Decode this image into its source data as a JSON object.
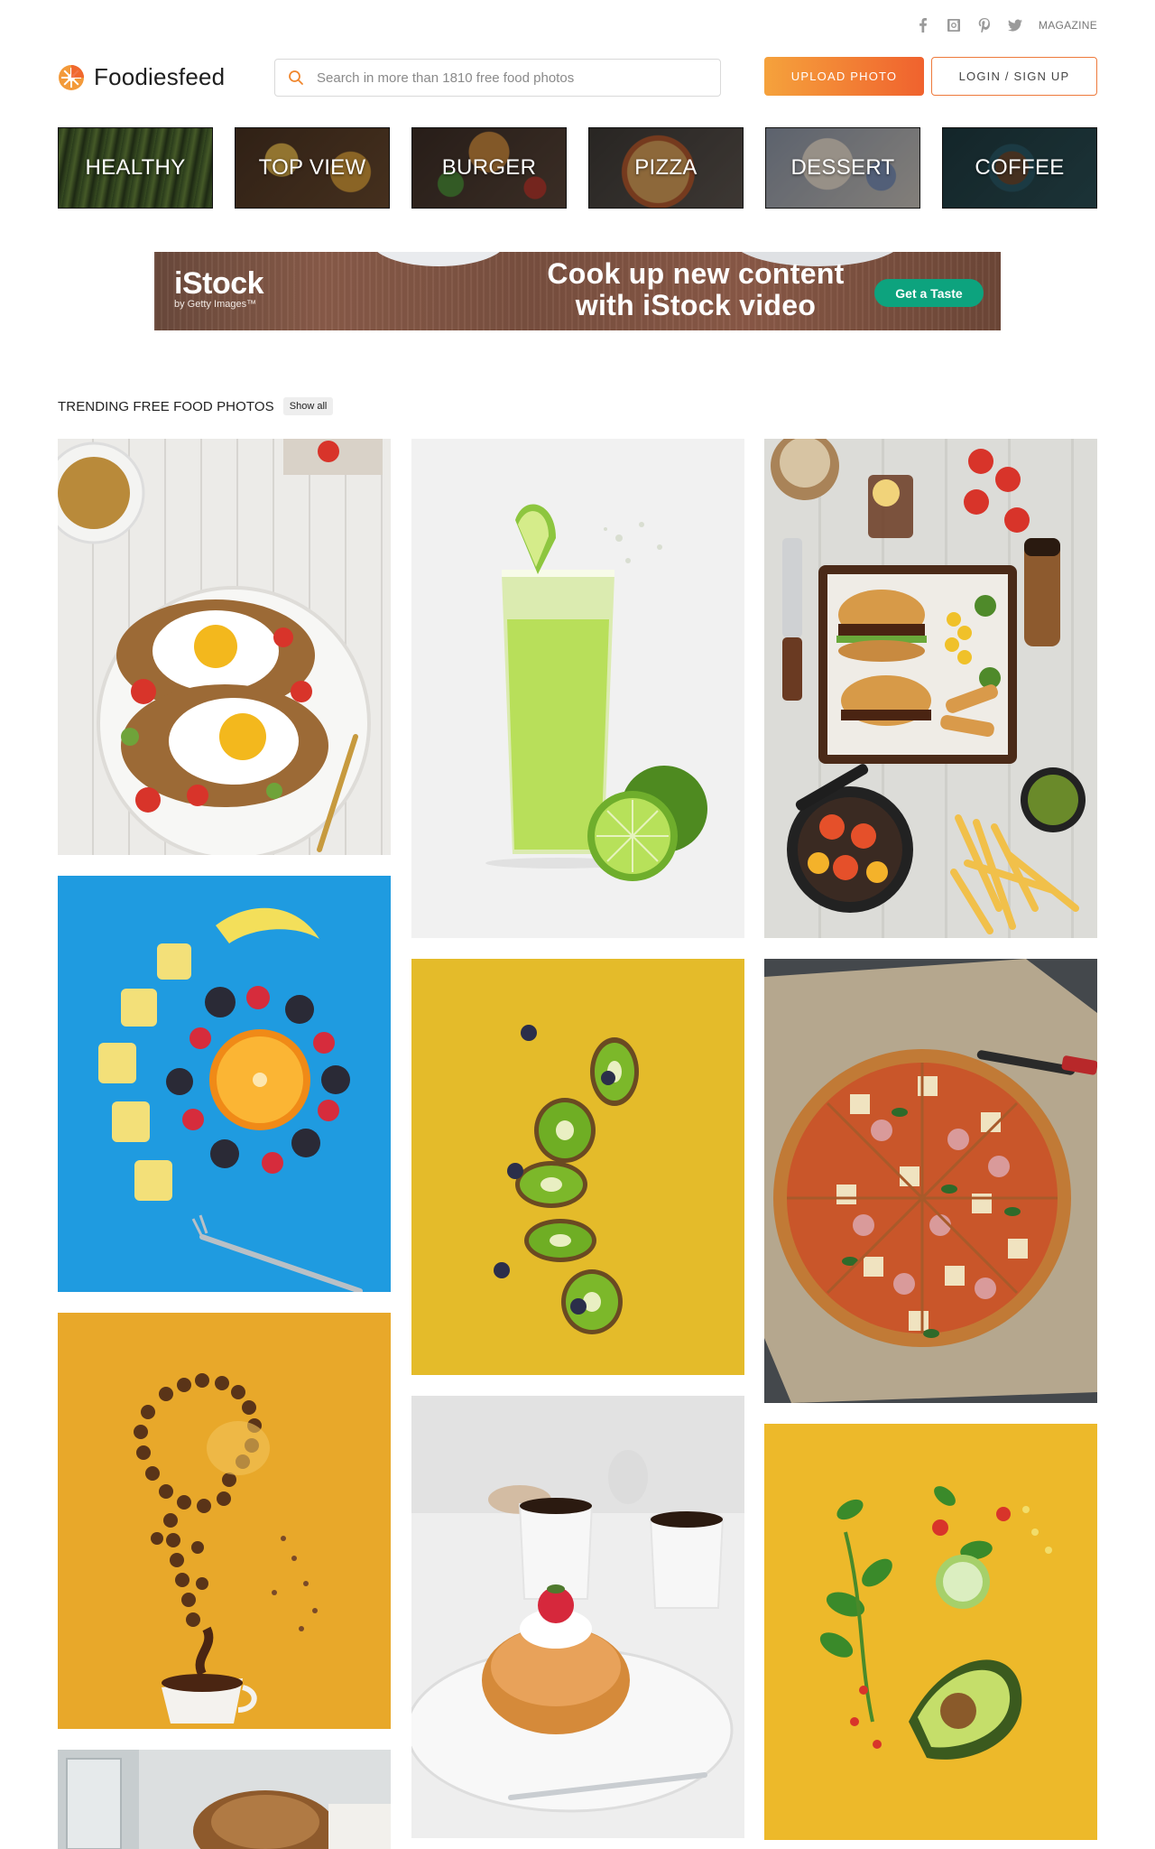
{
  "social": {
    "icons": [
      "facebook-icon",
      "instagram-icon",
      "pinterest-icon",
      "twitter-icon"
    ],
    "magazine_label": "MAGAZINE"
  },
  "header": {
    "logo_text": "Foodiesfeed",
    "search_placeholder": "Search in more than 1810 free food photos",
    "upload_label": "UPLOAD PHOTO",
    "login_label": "LOGIN / SIGN UP",
    "accent_gradient": [
      "#f5a23c",
      "#f0622e"
    ]
  },
  "categories": [
    {
      "label": "HEALTHY"
    },
    {
      "label": "TOP VIEW"
    },
    {
      "label": "BURGER"
    },
    {
      "label": "PIZZA"
    },
    {
      "label": "DESSERT"
    },
    {
      "label": "COFFEE"
    }
  ],
  "ad": {
    "brand": "iStock",
    "brand_sub": "by Getty Images™",
    "headline_line1": "Cook up new content",
    "headline_line2": "with iStock video",
    "cta": "Get a Taste"
  },
  "trending": {
    "title": "TRENDING FREE FOOD PHOTOS",
    "show_all": "Show all"
  },
  "photos": [
    {
      "name": "eggs-avocado-toast-photo"
    },
    {
      "name": "green-juice-lime-photo"
    },
    {
      "name": "burger-fries-tray-photo"
    },
    {
      "name": "fruit-spiral-blue-photo"
    },
    {
      "name": "floating-kiwi-slices-photo"
    },
    {
      "name": "pineapple-ham-pizza-photo"
    },
    {
      "name": "coffee-bean-splash-photo"
    },
    {
      "name": "donut-coffee-cups-photo"
    },
    {
      "name": "floating-avocado-salad-photo"
    },
    {
      "name": "pastry-glasses-photo"
    }
  ]
}
